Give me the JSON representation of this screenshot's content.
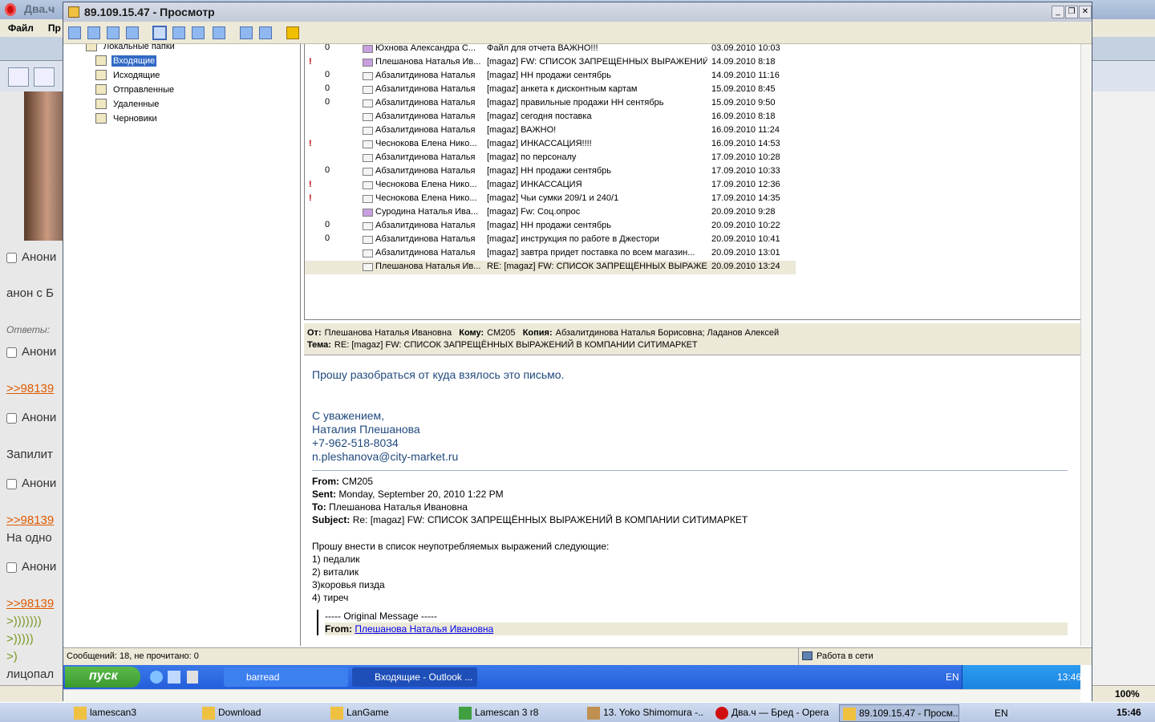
{
  "opera": {
    "title": "Два.ч",
    "menu": [
      "Файл",
      "Пр"
    ],
    "posts": [
      {
        "type": "checkbox",
        "label": "Анони"
      },
      {
        "type": "text",
        "label": "анон с Б"
      },
      {
        "type": "meta",
        "label": "Ответы:"
      },
      {
        "type": "checkbox",
        "label": "Анони"
      },
      {
        "type": "link",
        "label": ">>98139"
      },
      {
        "type": "checkbox",
        "label": "Анони"
      },
      {
        "type": "text",
        "label": "Запилит"
      },
      {
        "type": "checkbox",
        "label": "Анони"
      },
      {
        "type": "link",
        "label": ">>98139"
      },
      {
        "type": "text",
        "label": "На одно"
      },
      {
        "type": "checkbox",
        "label": "Анони"
      },
      {
        "type": "link",
        "label": ">>98139"
      },
      {
        "type": "greentext",
        "label": ">)))))))"
      },
      {
        "type": "greentext",
        "label": ">)))))"
      },
      {
        "type": "greentext",
        "label": ">)"
      },
      {
        "type": "text",
        "label": "лицопал"
      }
    ],
    "zoom": "100%"
  },
  "remote": {
    "title": "89.109.15.47 - Просмотр",
    "folders": [
      {
        "label": "Локальные папки"
      },
      {
        "label": "Входящие"
      },
      {
        "label": "Исходящие"
      },
      {
        "label": "Отправленные"
      },
      {
        "label": "Удаленные"
      },
      {
        "label": "Черновики"
      }
    ],
    "messages": [
      {
        "imp": "",
        "att": "0",
        "fw": true,
        "from": "Юхнова Александра С...",
        "subject": "Файл для отчета ВАЖНО!!!",
        "date": "03.09.2010 10:03"
      },
      {
        "imp": "!",
        "att": "",
        "fw": true,
        "from": "Плешанова Наталья Ив...",
        "subject": "[magaz] FW: СПИСОК ЗАПРЕЩЁННЫХ ВЫРАЖЕНИЙ...",
        "date": "14.09.2010 8:18"
      },
      {
        "imp": "",
        "att": "0",
        "fw": false,
        "from": "Абзалитдинова Наталья",
        "subject": "[magaz] НН продажи сентябрь",
        "date": "14.09.2010 11:16"
      },
      {
        "imp": "",
        "att": "0",
        "fw": false,
        "from": "Абзалитдинова Наталья",
        "subject": "[magaz] анкета к дисконтным картам",
        "date": "15.09.2010 8:45"
      },
      {
        "imp": "",
        "att": "0",
        "fw": false,
        "from": "Абзалитдинова Наталья",
        "subject": "[magaz] правильные продажи НН сентябрь",
        "date": "15.09.2010 9:50"
      },
      {
        "imp": "",
        "att": "",
        "fw": false,
        "from": "Абзалитдинова Наталья",
        "subject": "[magaz] сегодня поставка",
        "date": "16.09.2010 8:18"
      },
      {
        "imp": "",
        "att": "",
        "fw": false,
        "from": "Абзалитдинова Наталья",
        "subject": "[magaz] ВАЖНО!",
        "date": "16.09.2010 11:24"
      },
      {
        "imp": "!",
        "att": "",
        "fw": false,
        "from": "Чеснокова Елена Нико...",
        "subject": "[magaz] ИНКАССАЦИЯ!!!!",
        "date": "16.09.2010 14:53"
      },
      {
        "imp": "",
        "att": "",
        "fw": false,
        "from": "Абзалитдинова Наталья",
        "subject": "[magaz] по персоналу",
        "date": "17.09.2010 10:28"
      },
      {
        "imp": "",
        "att": "0",
        "fw": false,
        "from": "Абзалитдинова Наталья",
        "subject": "[magaz] НН продажи сентябрь",
        "date": "17.09.2010 10:33"
      },
      {
        "imp": "!",
        "att": "",
        "fw": false,
        "from": "Чеснокова Елена Нико...",
        "subject": "[magaz] ИНКАССАЦИЯ",
        "date": "17.09.2010 12:36"
      },
      {
        "imp": "!",
        "att": "",
        "fw": false,
        "from": "Чеснокова Елена Нико...",
        "subject": "[magaz] Чьи сумки 209/1 и 240/1",
        "date": "17.09.2010 14:35"
      },
      {
        "imp": "",
        "att": "",
        "fw": true,
        "from": "Суродина Наталья Ива...",
        "subject": "[magaz] Fw: Соц.опрос",
        "date": "20.09.2010 9:28"
      },
      {
        "imp": "",
        "att": "0",
        "fw": false,
        "from": "Абзалитдинова Наталья",
        "subject": "[magaz] НН продажи сентябрь",
        "date": "20.09.2010 10:22"
      },
      {
        "imp": "",
        "att": "0",
        "fw": false,
        "from": "Абзалитдинова Наталья",
        "subject": "[magaz] инструкция по работе в Джестори",
        "date": "20.09.2010 10:41"
      },
      {
        "imp": "",
        "att": "",
        "fw": false,
        "from": "Абзалитдинова Наталья",
        "subject": "[magaz] завтра придет поставка по всем магазин...",
        "date": "20.09.2010 13:01"
      },
      {
        "imp": "",
        "att": "",
        "fw": false,
        "from": "Плешанова Наталья Ив...",
        "subject": "RE: [magaz] FW: СПИСОК ЗАПРЕЩЁННЫХ ВЫРАЖЕ...",
        "date": "20.09.2010 13:24"
      }
    ],
    "preview": {
      "from_label": "От:",
      "from": "Плешанова Наталья Ивановна",
      "to_label": "Кому:",
      "to": "СМ205",
      "cc_label": "Копия:",
      "cc": "Абзалитдинова Наталья Борисовна; Ладанов Алексей",
      "subject_label": "Тема:",
      "subject": "RE: [magaz] FW: СПИСОК ЗАПРЕЩЁННЫХ ВЫРАЖЕНИЙ В КОМПАНИИ СИТИМАРКЕТ",
      "body_line1": "Прошу разобраться от куда взялось это письмо.",
      "sig": [
        "С уважением,",
        "Наталия Плешанова",
        "+7-962-518-8034",
        "n.pleshanova@city-market.ru"
      ],
      "q_from_label": "From:",
      "q_from": "CM205",
      "q_sent_label": "Sent:",
      "q_sent": "Monday, September 20, 2010 1:22 PM",
      "q_to_label": "To:",
      "q_to": "Плешанова Наталья Ивановна",
      "q_subject_label": "Subject:",
      "q_subject": "Re: [magaz] FW: СПИСОК ЗАПРЕЩЁННЫХ ВЫРАЖЕНИЙ В КОМПАНИИ СИТИМАРКЕТ",
      "q_body": [
        "Прошу внести в список неупотребляемых выражений следующие:",
        "1) педалик",
        "2) виталик",
        "3)коровья пизда",
        "4) тиреч"
      ],
      "orig_label": "----- Original Message -----",
      "orig_from_label": "From:",
      "orig_from": "Плешанова Наталья Ивановна"
    },
    "status_left": "Сообщений: 18, не прочитано: 0",
    "status_right": "Работа в сети",
    "start": "пуск",
    "task_items": [
      "barread",
      "Входящие - Outlook ..."
    ],
    "lang": "EN",
    "clock": "13:46"
  },
  "taskbar": {
    "items": [
      "lamescan3",
      "Download",
      "LanGame",
      "Lamescan 3 r8",
      "13. Yoko Shimomura -...",
      "Два.ч — Бред - Opera",
      "89.109.15.47 - Просм..."
    ],
    "lang": "EN",
    "clock": "15:46"
  }
}
